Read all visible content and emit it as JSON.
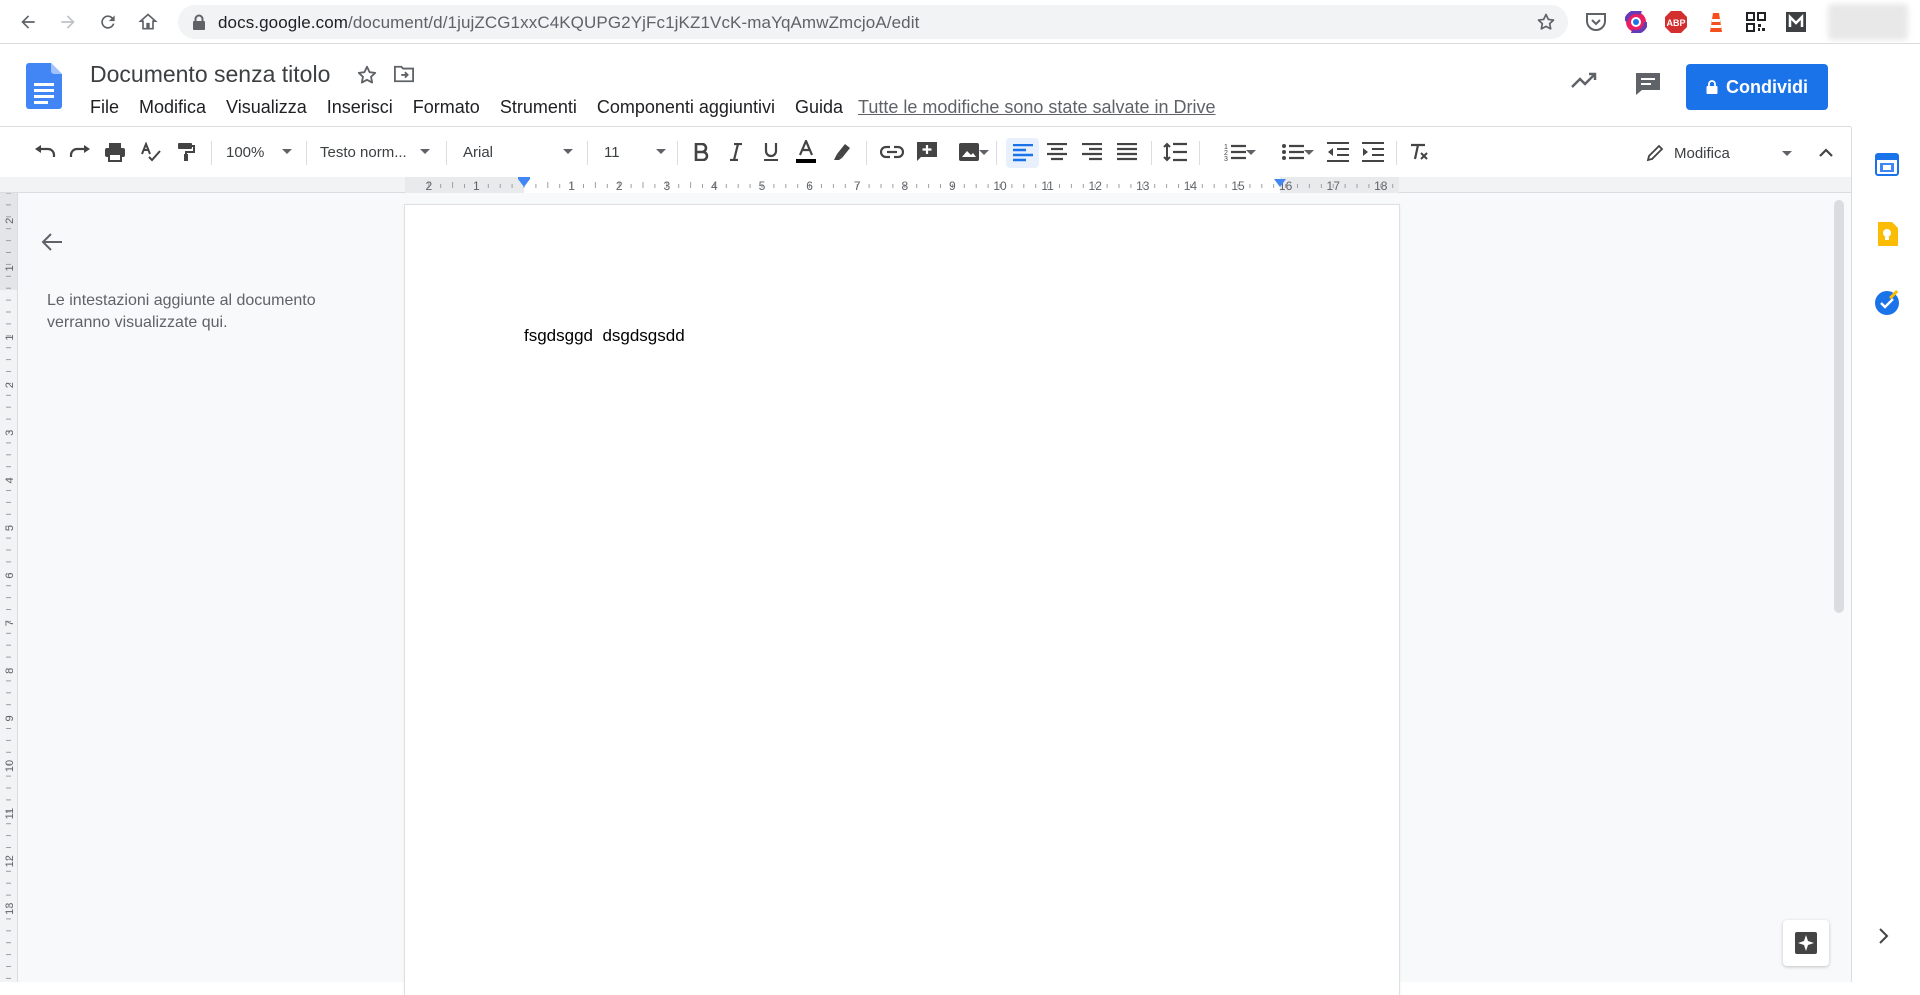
{
  "browser": {
    "url_host": "docs.google.com",
    "url_path": "/document/d/1jujZCG1xxC4KQUPG2YjFc1jKZ1VcK-maYqAmwZmcjoA/edit",
    "extensions": [
      "pocket-icon",
      "chrome-color-icon",
      "adblock-icon",
      "lighthouse-icon",
      "qr-code-icon",
      "mailtrack-icon"
    ],
    "ext_abp_label": "ABP"
  },
  "docs": {
    "title": "Documento senza titolo",
    "menu": [
      "File",
      "Modifica",
      "Visualizza",
      "Inserisci",
      "Formato",
      "Strumenti",
      "Componenti aggiuntivi",
      "Guida"
    ],
    "save_status": "Tutte le modifiche sono state salvate in Drive",
    "share_label": "Condividi"
  },
  "toolbar": {
    "zoom": "100%",
    "style": "Testo norm...",
    "font": "Arial",
    "font_size": "11",
    "mode": "Modifica"
  },
  "ruler": {
    "horizontal": [
      "2",
      "1",
      "1",
      "2",
      "3",
      "4",
      "5",
      "6",
      "7",
      "8",
      "9",
      "10",
      "11",
      "12",
      "13",
      "14",
      "15",
      "16",
      "17",
      "18"
    ],
    "vertical": [
      "2",
      "1",
      "1",
      "2",
      "3",
      "4",
      "5",
      "6",
      "7",
      "8",
      "9",
      "10",
      "11",
      "12",
      "13"
    ]
  },
  "outline": {
    "empty_text": "Le intestazioni aggiunte al documento verranno visualizzate qui."
  },
  "document": {
    "body": "fsgdsggd  dsgdsgsdd"
  },
  "colors": {
    "accent": "#1a73e8",
    "docs_blue": "#4285f4",
    "keep_yellow": "#fbbc04"
  }
}
